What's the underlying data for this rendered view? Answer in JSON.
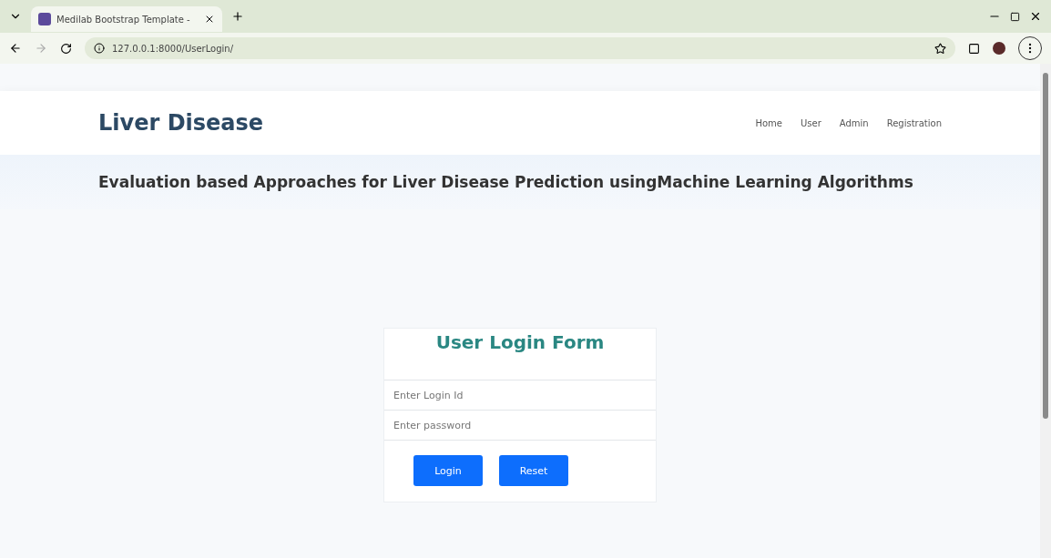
{
  "browser": {
    "tab_title": "Medilab Bootstrap Template -",
    "url": "127.0.0.1:8000/UserLogin/"
  },
  "header": {
    "logo": "Liver Disease",
    "nav": [
      {
        "label": "Home"
      },
      {
        "label": "User"
      },
      {
        "label": "Admin"
      },
      {
        "label": "Registration"
      }
    ]
  },
  "banner": {
    "title": "Evaluation based Approaches for Liver Disease Prediction usingMachine Learning Algorithms"
  },
  "form": {
    "title": "User Login Form",
    "fields": [
      {
        "placeholder": "Enter Login Id"
      },
      {
        "placeholder": "Enter password"
      }
    ],
    "buttons": [
      "Login",
      "Reset"
    ]
  }
}
